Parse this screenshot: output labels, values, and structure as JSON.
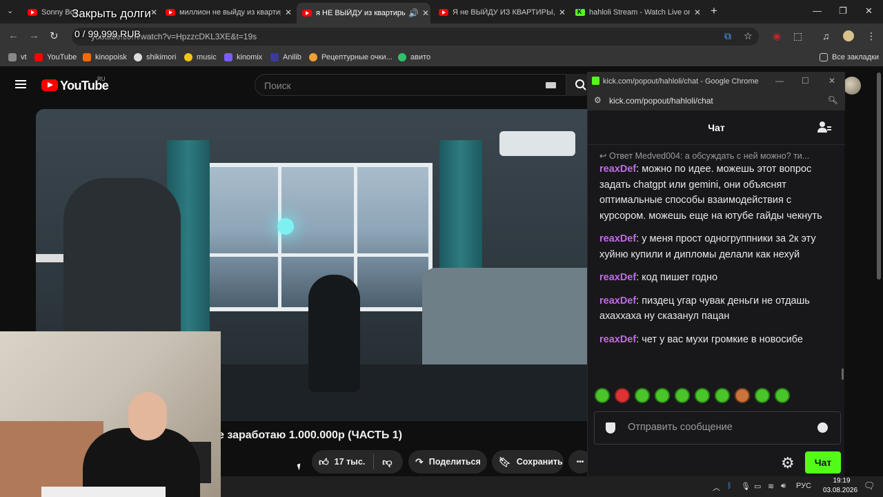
{
  "browser": {
    "tabs": [
      {
        "title": "Sonny Boy",
        "kind": "yt",
        "active": false
      },
      {
        "title": "миллион не выйду из квартир",
        "kind": "yt",
        "active": false
      },
      {
        "title": "я НЕ ВЫЙДУ из квартиры,",
        "kind": "yt",
        "active": true
      },
      {
        "title": "Я не ВЫЙДУ ИЗ КВАРТИРЫ, п",
        "kind": "yt",
        "active": false
      },
      {
        "title": "hahloli Stream - Watch Live on",
        "kind": "kick",
        "active": false
      }
    ],
    "new_tab": "+",
    "url": "youtube.com/watch?v=HpzzcDKL3XE&t=19s",
    "bookmarks": [
      {
        "label": "vt",
        "color": "#ff0000"
      },
      {
        "label": "YouTube",
        "color": "#ff0000"
      },
      {
        "label": "kinopoisk",
        "color": "#ff6a00"
      },
      {
        "label": "shikimori",
        "color": "#dddddd"
      },
      {
        "label": "music",
        "color": "#f5c518"
      },
      {
        "label": "kinomix",
        "color": "#7b5cff"
      },
      {
        "label": "Anilib",
        "color": "#3a3a9a"
      },
      {
        "label": "Рецептурные очки...",
        "color": "#f0a030"
      },
      {
        "label": "авито",
        "color": "#2fc36a"
      }
    ],
    "all_bookmarks": "Все закладки"
  },
  "overlay": {
    "title": "Закрыть долги",
    "goal": "0 / 99,999 RUB"
  },
  "youtube": {
    "logo_text": "YouTube",
    "region": "RU",
    "search_placeholder": "Поиск",
    "video_title": "е заработаю 1.000.000р (ЧАСТЬ 1)",
    "likes": "17 тыс.",
    "share": "Поделиться",
    "save": "Сохранить",
    "more": "•••"
  },
  "chat": {
    "window_title": "kick.com/popout/hahloli/chat - Google Chrome",
    "url": "kick.com/popout/hahloli/chat",
    "header": "Чат",
    "reply": "Ответ Medved004: а обсуждать с ней можно? ти...",
    "messages": [
      {
        "user": "reaxDef",
        "text": "можно по идее. можешь этот вопрос задать chatgpt или gemini, они объяснят оптимальные способы взаимодействия с курсором. можешь еще на ютубе гайды чекнуть"
      },
      {
        "user": "reaxDef",
        "text": "у меня прост одногруппники за 2к эту хуйню купили и дипломы делали как нехуй"
      },
      {
        "user": "reaxDef",
        "text": "код пишет годно"
      },
      {
        "user": "reaxDef",
        "text": "пиздец угар чувак деньги не отдашь ахаххаха ну сказанул пацан"
      },
      {
        "user": "reaxDef",
        "text": "чет у вас мухи громкие в новосибе"
      }
    ],
    "input_placeholder": "Отправить сообщение",
    "send": "Чат",
    "accent": "#53fc18",
    "username_color": "#c06be7"
  },
  "taskbar": {
    "lang": "РУС",
    "time": "19:19",
    "date": "03.08.2026"
  }
}
